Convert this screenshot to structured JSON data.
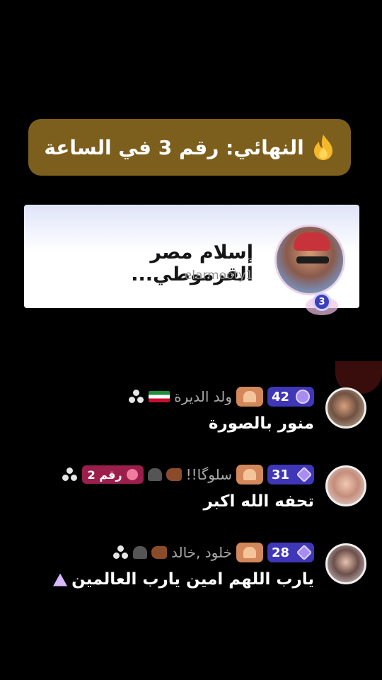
{
  "rank_banner": {
    "icon": "flame-icon",
    "text": "النهائي: رقم 3 في الساعة",
    "color": "#7d5f1d"
  },
  "creator": {
    "name": "إسلام مصر القرموطي...",
    "handle": "elarmooty1",
    "rank": "3"
  },
  "comments": [
    {
      "level": "42",
      "username": "ولد الديرة",
      "text": "منور بالصورة"
    },
    {
      "level": "31",
      "username": "سلوگا!!",
      "rank_badge": "رقم 2",
      "text": "تحفه الله اكبر"
    },
    {
      "level": "28",
      "username": "خلود ,خالد",
      "text": "يارب اللهم امين يارب العالمين"
    }
  ]
}
